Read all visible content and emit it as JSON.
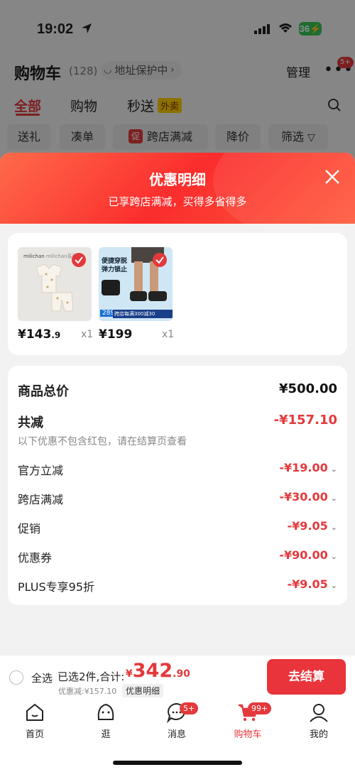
{
  "status": {
    "time": "19:02",
    "battery": "36"
  },
  "header": {
    "title": "购物车",
    "count": "(128)",
    "address": "地址保护中",
    "manage": "管理",
    "more_badge": "5+"
  },
  "tabs": [
    {
      "label": "全部"
    },
    {
      "label": "购物"
    },
    {
      "label": "秒送"
    }
  ],
  "waimai_badge": "外卖",
  "chips": [
    {
      "label": "送礼"
    },
    {
      "label": "凑单"
    },
    {
      "label": "跨店满减",
      "tag": "促"
    },
    {
      "label": "降价"
    },
    {
      "label": "筛选"
    }
  ],
  "sheet": {
    "title": "优惠明细",
    "subtitle": "已享跨店满减，买得多省得多"
  },
  "products": [
    {
      "price_int": "¥143",
      "price_dec": ".9",
      "qty": "x1",
      "brand": "milichan",
      "tag": "milichan系列"
    },
    {
      "price_int": "¥199",
      "price_dec": "",
      "qty": "x1",
      "text1": "便捷穿脱",
      "text2": "弹力锁止",
      "price_tag": "289",
      "promo": "跨店每满300减30"
    }
  ],
  "summary": {
    "total_label": "商品总价",
    "total_value": "¥500.00",
    "reduce_label": "共减",
    "reduce_value": "-¥157.10",
    "note": "以下优惠不包含红包，请在结算页查看",
    "items": [
      {
        "label": "官方立减",
        "value": "-¥19.00"
      },
      {
        "label": "跨店满减",
        "value": "-¥30.00"
      },
      {
        "label": "促销",
        "value": "-¥9.05"
      },
      {
        "label": "优惠券",
        "value": "-¥90.00"
      },
      {
        "label": "PLUS专享95折",
        "value": "-¥9.05"
      }
    ]
  },
  "bottom": {
    "select_all": "全选",
    "selected": "已选2件,合计:",
    "currency": "¥",
    "total_int": "342",
    "total_dec": ".90",
    "discount": "优惠减:¥157.10",
    "detail": "优惠明细",
    "checkout": "去结算"
  },
  "tabbar": [
    {
      "label": "首页",
      "icon": "home-icon"
    },
    {
      "label": "逛",
      "icon": "face-icon"
    },
    {
      "label": "消息",
      "icon": "message-icon",
      "badge": "5+"
    },
    {
      "label": "购物车",
      "icon": "cart-icon",
      "badge": "99+"
    },
    {
      "label": "我的",
      "icon": "user-icon"
    }
  ],
  "colors": {
    "accent": "#e4393c"
  }
}
